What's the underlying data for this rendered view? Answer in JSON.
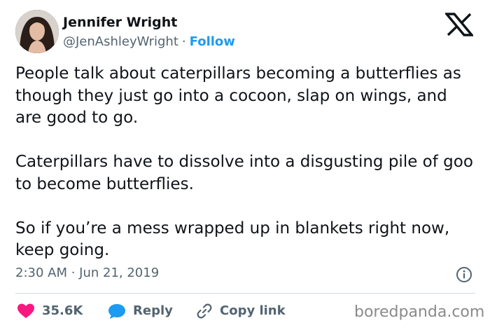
{
  "author": {
    "name": "Jennifer Wright",
    "handle": "@JenAshleyWright",
    "separator": "·",
    "follow_label": "Follow"
  },
  "tweet": {
    "paragraphs": [
      "People talk about caterpillars becoming a butterflies as though they just go into a cocoon, slap on wings, and are good to go.",
      "Caterpillars have to dissolve into a disgusting pile of goo to become butterflies.",
      "So if you’re a mess wrapped up in blankets right now, keep going."
    ],
    "timestamp": "2:30 AM · Jun 21, 2019"
  },
  "actions": {
    "like_count": "35.6K",
    "reply_label": "Reply",
    "copy_link_label": "Copy link"
  },
  "icons": {
    "platform_logo": "x-logo-icon",
    "info": "info-icon",
    "like": "heart-icon",
    "reply": "speech-bubble-icon",
    "copy_link": "link-icon"
  },
  "colors": {
    "accent": "#1d9bf0",
    "like": "#f91880",
    "text": "#0f1419",
    "secondary": "#536471"
  },
  "watermark": "boredpanda.com"
}
